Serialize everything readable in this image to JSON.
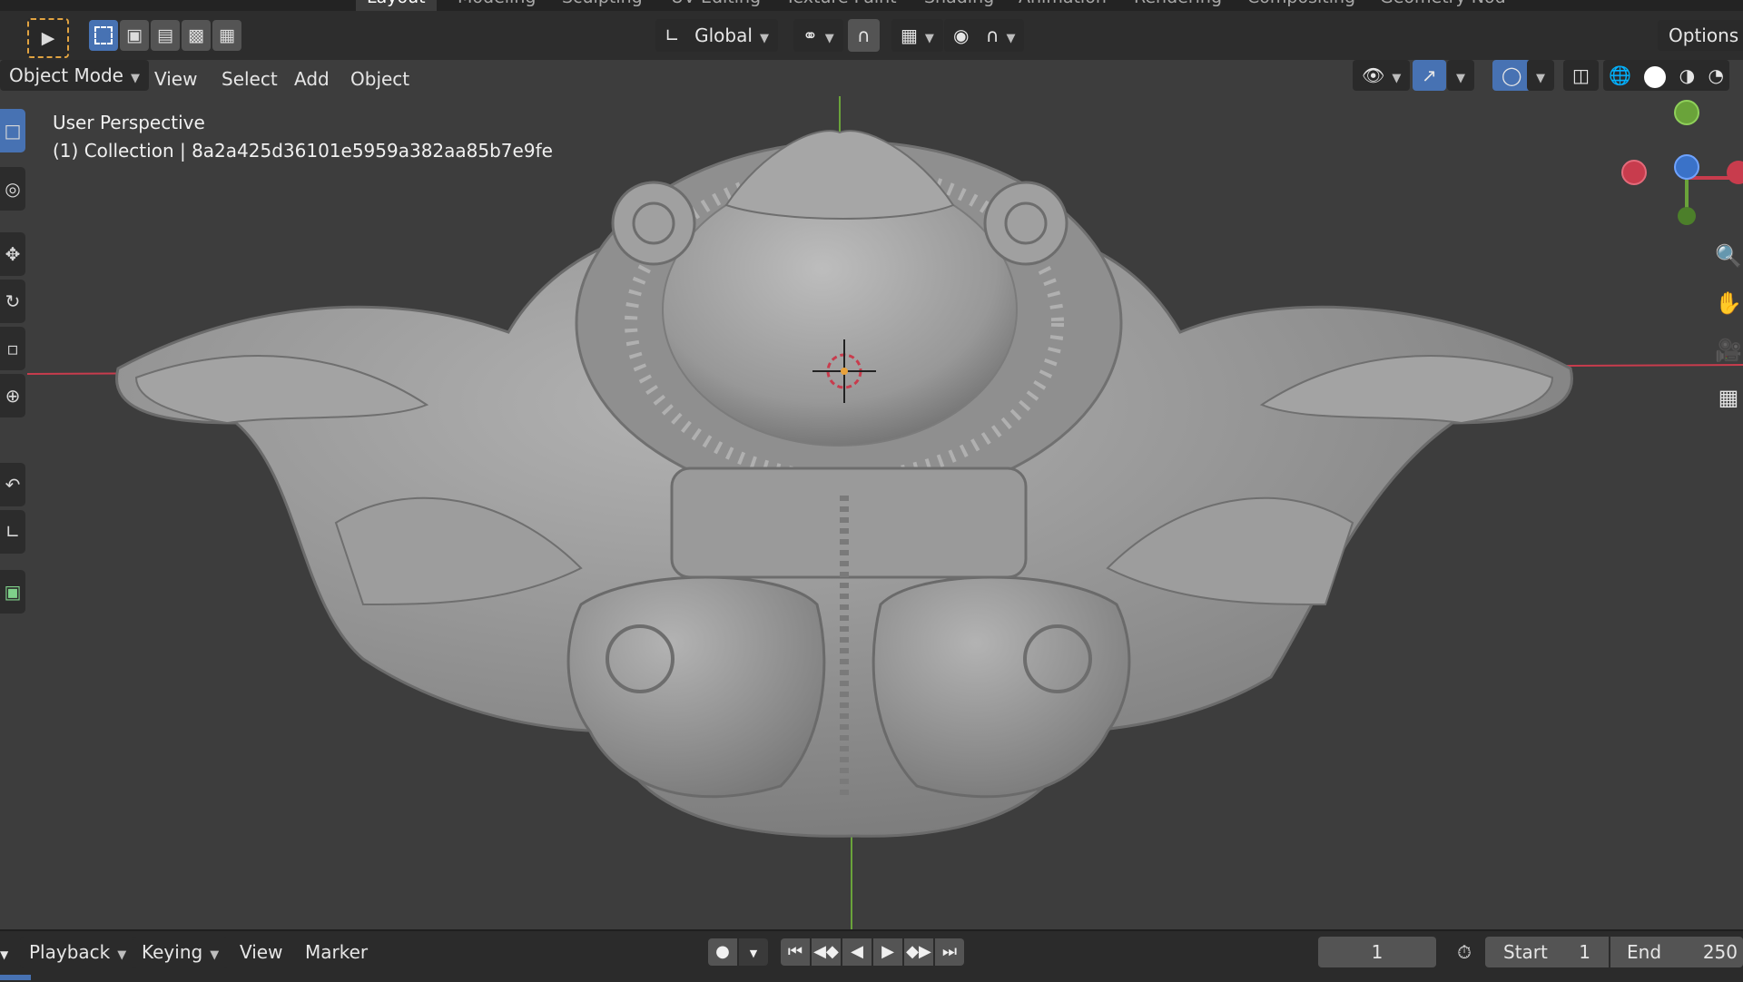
{
  "workspace_tabs": [
    "Layout",
    "Modeling",
    "Sculpting",
    "UV Editing",
    "Texture Paint",
    "Shading",
    "Animation",
    "Rendering",
    "Compositing",
    "Geometry Nod"
  ],
  "header": {
    "transform_orientation": "Global",
    "options_label": "Options",
    "mode": "Object Mode",
    "menus": [
      "View",
      "Select",
      "Add",
      "Object"
    ]
  },
  "viewport": {
    "perspective_label": "User Perspective",
    "collection_label": "(1) Collection | 8a2a425d36101e5959a382aa85b7e9fe",
    "gizmo_axes": {
      "x": "X",
      "y": "Y",
      "z": "Z"
    },
    "colors": {
      "x_axis": "#c83c4d",
      "y_axis": "#6aa33a",
      "z_axis": "#3a72c8",
      "background": "#3d3d3d",
      "model": "#a8a8a8",
      "accent": "#4772b3"
    }
  },
  "timeline": {
    "menus": [
      "Playback",
      "Keying",
      "View",
      "Marker"
    ],
    "current_frame": "1",
    "start_label": "Start",
    "start_value": "1",
    "end_label": "End",
    "end_value": "250"
  },
  "icons": [
    "select-box-icon",
    "cursor-icon",
    "move-icon",
    "rotate-icon",
    "scale-icon",
    "transform-icon",
    "annotate-icon",
    "measure-icon",
    "add-cube-icon",
    "zoom-icon",
    "hand-pan-icon",
    "camera-icon",
    "grid-icon",
    "snap-magnet-icon",
    "proportional-edit-icon",
    "visibility-eye-icon",
    "gizmo-icon",
    "overlay-icon",
    "xray-icon",
    "wireframe-shading-icon",
    "solid-shading-icon",
    "material-shading-icon",
    "rendered-shading-icon",
    "record-icon",
    "jump-start-icon",
    "prev-keyframe-icon",
    "play-reverse-icon",
    "play-icon",
    "next-keyframe-icon",
    "jump-end-icon",
    "stopwatch-icon",
    "3d-cursor-icon"
  ]
}
